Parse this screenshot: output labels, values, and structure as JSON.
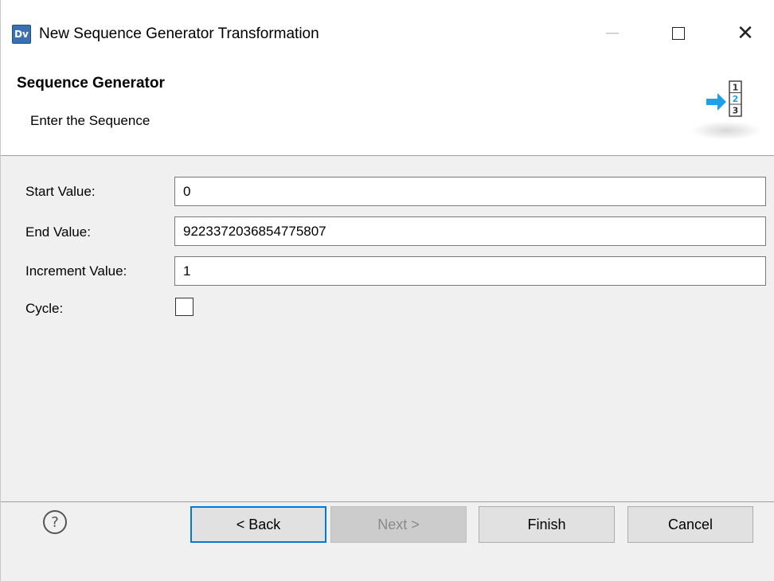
{
  "window": {
    "title": "New Sequence Generator Transformation",
    "app_icon_text": "Dv",
    "minimize_icon": "minimize-icon",
    "maximize_icon": "maximize-icon",
    "close_icon": "close-icon",
    "close_glyph": "✕"
  },
  "header": {
    "title": "Sequence Generator",
    "subtitle": "Enter the Sequence",
    "icon": "sequence-generator-icon",
    "icon_digits": [
      "1",
      "2",
      "3"
    ]
  },
  "form": {
    "start_label": "Start Value:",
    "start_value": "0",
    "end_label": "End Value:",
    "end_value": "9223372036854775807",
    "increment_label": "Increment Value:",
    "increment_value": "1",
    "cycle_label": "Cycle:",
    "cycle_checked": false
  },
  "footer": {
    "help_icon": "help-icon",
    "back_label": "< Back",
    "next_label": "Next >",
    "finish_label": "Finish",
    "cancel_label": "Cancel"
  },
  "colors": {
    "accent": "#0078d7",
    "icon_arrow": "#1e9fe6",
    "background": "#f0f0f0"
  }
}
